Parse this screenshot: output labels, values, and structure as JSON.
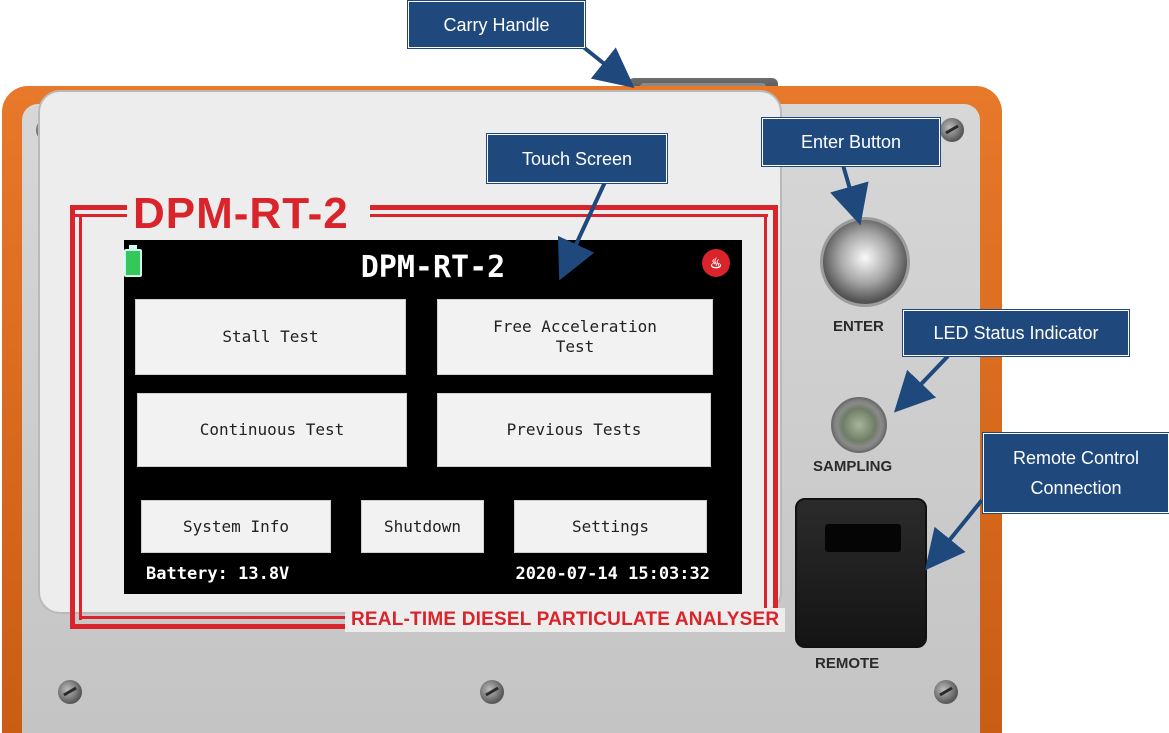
{
  "device": {
    "brand_title": "DPM-RT-2",
    "brand_subtitle": "REAL-TIME DIESEL PARTICULATE ANALYSER",
    "enter_label": "ENTER",
    "sampling_label": "SAMPLING",
    "remote_label": "REMOTE"
  },
  "screen": {
    "title": "DPM-RT-2",
    "battery_icon": "battery-icon",
    "heater_icon": "heater-icon",
    "buttons": {
      "stall_test": "Stall Test",
      "free_acceleration_test": "Free Acceleration\nTest",
      "continuous_test": "Continuous Test",
      "previous_tests": "Previous Tests",
      "system_info": "System Info",
      "shutdown": "Shutdown",
      "settings": "Settings"
    },
    "battery_status": "Battery: 13.8V",
    "datetime": "2020-07-14 15:03:32"
  },
  "callouts": {
    "carry_handle": "Carry Handle",
    "touch_screen": "Touch Screen",
    "enter_button": "Enter Button",
    "led_status_indicator": "LED Status Indicator",
    "remote_control_connection": "Remote Control\nConnection"
  },
  "colors": {
    "callout_bg": "#1f497d",
    "device_orange": "#e8782a",
    "brand_red": "#d8242a",
    "screen_bg": "#000000",
    "screen_button_bg": "#f2f2f2"
  }
}
